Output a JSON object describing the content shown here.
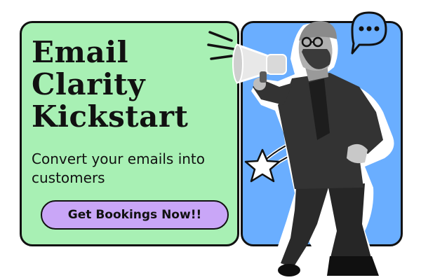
{
  "banner": {
    "headline_lines": [
      "Email",
      "Clarity",
      "Kickstart"
    ],
    "subhead": "Convert your emails into customers",
    "cta_label": "Get Bookings Now!!"
  },
  "colors": {
    "green_panel": "#a8f0b4",
    "blue_panel": "#6aaeff",
    "cta_fill": "#c9a6f7",
    "outline": "#111111",
    "chat_bubble": "#6aaeff"
  },
  "icons": {
    "chat_bubble": "chat-bubble-icon",
    "megaphone": "megaphone-icon",
    "star": "shooting-star-icon",
    "burst": "burst-lines-icon"
  }
}
